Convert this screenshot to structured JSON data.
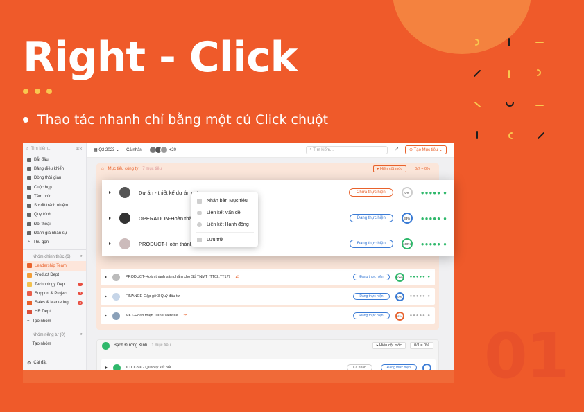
{
  "slide": {
    "title": "Right - Click",
    "bullet": "Thao tác nhanh chỉ bằng một cú Click chuột",
    "number": "01"
  },
  "colors": {
    "background": "#ef5a2a",
    "accent": "#f9c74f",
    "brand": "#e8622c",
    "progress_blue": "#3a7bd5",
    "success": "#2fb86b"
  },
  "sidebar": {
    "search": "Tìm kiếm...",
    "shortcut": "⌘K",
    "items": [
      {
        "label": "Bắt đầu",
        "icon": "home-icon"
      },
      {
        "label": "Bảng điều khiển",
        "icon": "dashboard-icon"
      },
      {
        "label": "Dòng thời gian",
        "icon": "timeline-icon"
      },
      {
        "label": "Cuộc họp",
        "icon": "meeting-icon"
      },
      {
        "label": "Tầm nhìn",
        "icon": "vision-icon"
      },
      {
        "label": "Sơ đồ trách nhiệm",
        "icon": "org-chart-icon"
      },
      {
        "label": "Quy trình",
        "icon": "process-icon"
      },
      {
        "label": "Đối thoại",
        "icon": "chat-icon"
      },
      {
        "label": "Đánh giá nhân sự",
        "icon": "review-icon"
      },
      {
        "label": "Thu gọn",
        "icon": "collapse-icon"
      }
    ],
    "teams_header": "Nhóm chính thức (6)",
    "teams": [
      {
        "label": "Leadership Team",
        "color": "#e8622c",
        "badge": ""
      },
      {
        "label": "Product Dept",
        "color": "#f29d38",
        "badge": ""
      },
      {
        "label": "Technology Dept",
        "color": "#f2c14e",
        "badge": "1"
      },
      {
        "label": "Support & Project...",
        "color": "#e85d4a",
        "badge": "2"
      },
      {
        "label": "Sales & Marketing...",
        "color": "#e8622c",
        "badge": "2"
      },
      {
        "label": "HR Dept",
        "color": "#d9503b",
        "badge": ""
      }
    ],
    "create_group": "Tạo nhóm",
    "private_header": "Nhóm riêng tư (0)",
    "create_group2": "Tạo nhóm",
    "settings": "Cài đặt"
  },
  "topbar": {
    "quarter": "Q2 2023",
    "personal": "Cá nhân",
    "more_avatars": "+20",
    "search": "Tìm kiếm...",
    "create": "Tạo Mục tiêu"
  },
  "group1": {
    "title": "Mục tiêu công ty",
    "count": "7 mục tiêu",
    "show_btn": "Hiện cột mốc",
    "progress": "0/7 = 0%"
  },
  "rows": [
    {
      "text": "PRODUCT-Hoàn thành sản phẩm cho Số TNMT (TT02,TT17)",
      "status": "Đang thực hiện",
      "pct": "100%"
    },
    {
      "text": "FINANCE-Gặp gỡ 3 Quỹ đầu tư",
      "status": "Đang thực hiện",
      "pct": "0%"
    },
    {
      "text": "MKT-Hoàn thiện 100% website",
      "status": "Đang thực hiện",
      "pct": "0%"
    }
  ],
  "group2": {
    "title": "Bạch Đường Kính",
    "count": "1 mục tiêu",
    "show_btn": "Hiện cột mốc",
    "progress": "0/1 = 0%",
    "row_text": "IOT Core - Quản lý kết nối",
    "row_tag": "Cá nhân",
    "row_status": "Đang thực hiện"
  },
  "popup_rows": [
    {
      "text": "Dự án - thiết kế dự án outsource",
      "status": "Chưa thực hiện",
      "pct": "0%"
    },
    {
      "text": "OPERATION-Hoàn thành ... văn hóa",
      "status": "Đang thực hiện",
      "pct": "33%"
    },
    {
      "text": "PRODUCT-Hoàn thành ... (TT02,TT17)",
      "status": "Đang thực hiện",
      "pct": "100%"
    }
  ],
  "context_menu": [
    {
      "label": "Nhân bản Mục tiêu",
      "icon": "duplicate-icon"
    },
    {
      "label": "Liên kết Vấn đề",
      "icon": "link-issue-icon"
    },
    {
      "label": "Liên kết Hành động",
      "icon": "link-action-icon"
    },
    {
      "label": "Lưu trữ",
      "icon": "archive-icon"
    }
  ]
}
